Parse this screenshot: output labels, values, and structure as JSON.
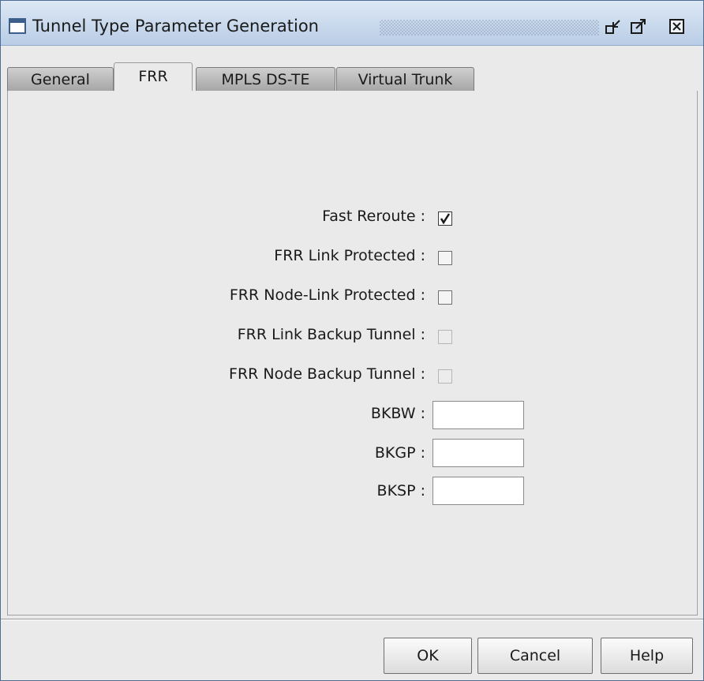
{
  "window": {
    "title": "Tunnel Type Parameter Generation"
  },
  "titlebar_buttons": [
    {
      "name": "minimize-icon"
    },
    {
      "name": "maximize-icon"
    },
    {
      "name": "close-icon"
    }
  ],
  "tabs": [
    {
      "label": "General",
      "active": false
    },
    {
      "label": "FRR",
      "active": true
    },
    {
      "label": "MPLS DS-TE",
      "active": false
    },
    {
      "label": "Virtual Trunk",
      "active": false
    }
  ],
  "form": {
    "fast_reroute": {
      "label": "Fast Reroute :",
      "checked": true,
      "enabled": true
    },
    "frr_link_protected": {
      "label": "FRR Link Protected :",
      "checked": false,
      "enabled": true
    },
    "frr_node_link_protected": {
      "label": "FRR Node-Link Protected :",
      "checked": false,
      "enabled": true
    },
    "frr_link_backup_tunnel": {
      "label": "FRR Link Backup Tunnel :",
      "checked": false,
      "enabled": false
    },
    "frr_node_backup_tunnel": {
      "label": "FRR Node Backup Tunnel :",
      "checked": false,
      "enabled": false
    },
    "bkbw": {
      "label": "BKBW :",
      "value": ""
    },
    "bkgp": {
      "label": "BKGP :",
      "value": ""
    },
    "bksp": {
      "label": "BKSP :",
      "value": ""
    }
  },
  "buttons": {
    "ok": "OK",
    "cancel": "Cancel",
    "help": "Help"
  }
}
